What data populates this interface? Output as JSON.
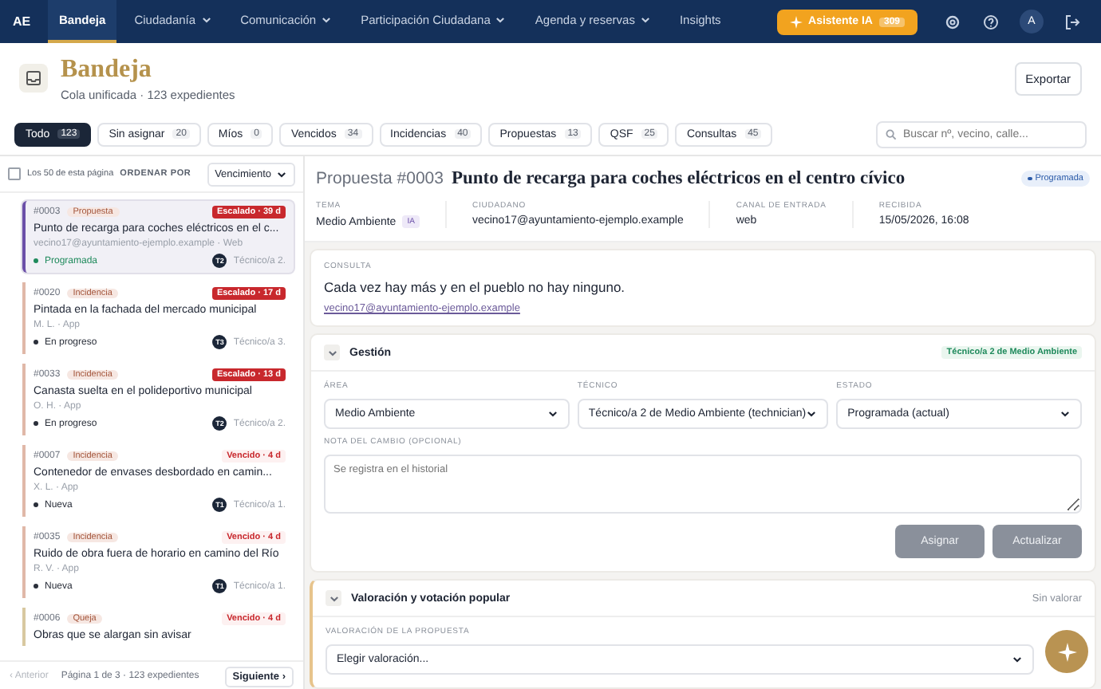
{
  "nav": {
    "logo": "AE",
    "items": [
      {
        "label": "Bandeja",
        "selected": true,
        "dropdown": false
      },
      {
        "label": "Ciudadanía",
        "selected": false,
        "dropdown": true
      },
      {
        "label": "Comunicación",
        "selected": false,
        "dropdown": true
      },
      {
        "label": "Participación Ciudadana",
        "selected": false,
        "dropdown": true
      },
      {
        "label": "Agenda y reservas",
        "selected": false,
        "dropdown": true
      },
      {
        "label": "Insights",
        "selected": false,
        "dropdown": false
      }
    ],
    "assistant": {
      "label": "Asistente IA",
      "count": "309"
    },
    "avatar": "A"
  },
  "header": {
    "title": "Bandeja",
    "subtitle": "Cola unificada · 123 expedientes",
    "export": "Exportar"
  },
  "tabs": [
    {
      "label": "Todo",
      "count": "123",
      "selected": true
    },
    {
      "label": "Sin asignar",
      "count": "20",
      "selected": false
    },
    {
      "label": "Míos",
      "count": "0",
      "selected": false
    },
    {
      "label": "Vencidos",
      "count": "34",
      "selected": false
    },
    {
      "label": "Incidencias",
      "count": "40",
      "selected": false
    },
    {
      "label": "Propuestas",
      "count": "13",
      "selected": false
    },
    {
      "label": "QSF",
      "count": "25",
      "selected": false
    },
    {
      "label": "Consultas",
      "count": "45",
      "selected": false
    }
  ],
  "search": {
    "placeholder": "Buscar nº, vecino, calle..."
  },
  "list_toolbar": {
    "select_all": "Los 50 de esta página",
    "checked": false,
    "sort_label": "ORDENAR POR",
    "sort_value": "Vencimiento"
  },
  "items": [
    {
      "id": "#0003",
      "type": "Propuesta",
      "badge": "Escalado · 39 d",
      "escalated": true,
      "title": "Punto de recarga para coches eléctricos en el c...",
      "sub": "vecino17@ayuntamiento-ejemplo.example · Web",
      "status": {
        "label": "Programada",
        "color": "#1f8a5c"
      },
      "tech_initials": "T2",
      "tech": "Técnico/a 2.",
      "selected": true,
      "color": "#6b4fa8"
    },
    {
      "id": "#0020",
      "type": "Incidencia",
      "badge": "Escalado · 17 d",
      "escalated": true,
      "title": "Pintada en la fachada del mercado municipal",
      "sub": "M. L. · App",
      "status": {
        "label": "En progreso",
        "color": "#2a2f3a"
      },
      "tech_initials": "T3",
      "tech": "Técnico/a 3.",
      "selected": false,
      "color": "#e0b8a8"
    },
    {
      "id": "#0033",
      "type": "Incidencia",
      "badge": "Escalado · 13 d",
      "escalated": true,
      "title": "Canasta suelta en el polideportivo municipal",
      "sub": "O. H. · App",
      "status": {
        "label": "En progreso",
        "color": "#2a2f3a"
      },
      "tech_initials": "T2",
      "tech": "Técnico/a 2.",
      "selected": false,
      "color": "#e0b8a8"
    },
    {
      "id": "#0007",
      "type": "Incidencia",
      "badge": "Vencido · 4 d",
      "escalated": false,
      "title": "Contenedor de envases desbordado en camin...",
      "sub": "X. L. · App",
      "status": {
        "label": "Nueva",
        "color": "#2a2f3a"
      },
      "tech_initials": "T1",
      "tech": "Técnico/a 1.",
      "selected": false,
      "color": "#e0b8a8"
    },
    {
      "id": "#0035",
      "type": "Incidencia",
      "badge": "Vencido · 4 d",
      "escalated": false,
      "title": "Ruido de obra fuera de horario en camino del Río",
      "sub": "R. V. · App",
      "status": {
        "label": "Nueva",
        "color": "#2a2f3a"
      },
      "tech_initials": "T1",
      "tech": "Técnico/a 1.",
      "selected": false,
      "color": "#e0b8a8"
    },
    {
      "id": "#0006",
      "type": "Queja",
      "badge": "Vencido · 4 d",
      "escalated": false,
      "title": "Obras que se alargan sin avisar",
      "selected": false,
      "color": "#d8c8a0"
    }
  ],
  "pager": {
    "prev": "‹ Anterior",
    "info": "Página 1 de 3 · 123 expedientes",
    "next": "Siguiente ›"
  },
  "detail": {
    "kind_label": "Propuesta #0003",
    "title": "Punto de recarga para coches eléctricos en el centro cívico",
    "status": "Programada",
    "meta": [
      {
        "label": "TEMA",
        "value": "Medio Ambiente",
        "tag": "IA"
      },
      {
        "label": "CIUDADANO",
        "value": "vecino17@ayuntamiento-ejemplo.example"
      },
      {
        "label": "CANAL DE ENTRADA",
        "value": "web"
      },
      {
        "label": "RECIBIDA",
        "value": "15/05/2026, 16:08"
      }
    ],
    "consulta": {
      "label": "CONSULTA",
      "text": "Cada vez hay más y en el pueblo no hay ninguno.",
      "email": "vecino17@ayuntamiento-ejemplo.example"
    },
    "gestion": {
      "title": "Gestión",
      "assignee": "Técnico/a 2 de Medio Ambiente",
      "fields": [
        {
          "label": "ÁREA",
          "value": "Medio Ambiente"
        },
        {
          "label": "TÉCNICO",
          "value": "Técnico/a 2 de Medio Ambiente (technician)"
        },
        {
          "label": "ESTADO",
          "value": "Programada (actual)"
        }
      ],
      "note_label": "NOTA DEL CAMBIO (OPCIONAL)",
      "note_placeholder": "Se registra en el historial",
      "buttons": [
        "Asignar",
        "Actualizar"
      ]
    },
    "valoracion": {
      "title": "Valoración y votación popular",
      "state": "Sin valorar",
      "field_label": "VALORACIÓN DE LA PROPUESTA",
      "field_value": "Elegir valoración..."
    }
  }
}
